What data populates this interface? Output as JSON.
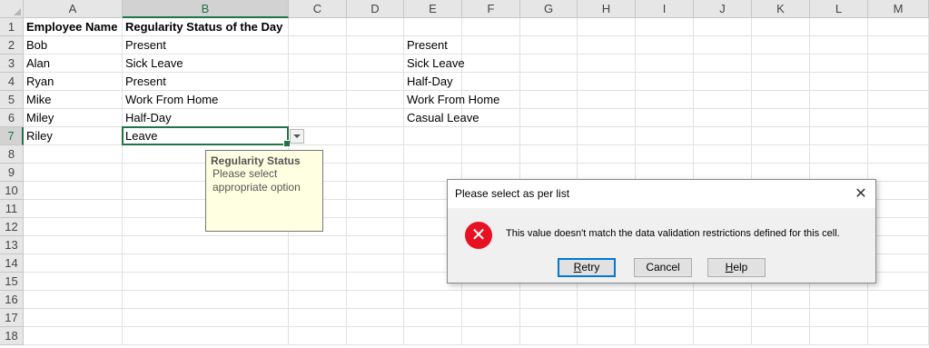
{
  "columns": [
    "A",
    "B",
    "C",
    "D",
    "E",
    "F",
    "G",
    "H",
    "I",
    "J",
    "K",
    "L",
    "M"
  ],
  "rows": [
    "1",
    "2",
    "3",
    "4",
    "5",
    "6",
    "7",
    "8",
    "9",
    "10",
    "11",
    "12",
    "13",
    "14",
    "15",
    "16",
    "17",
    "18"
  ],
  "cells": {
    "A1": "Employee Name",
    "B1": "Regularity Status of the Day",
    "A2": "Bob",
    "B2": "Present",
    "A3": "Alan",
    "B3": "Sick Leave",
    "A4": "Ryan",
    "B4": "Present",
    "A5": "Mike",
    "B5": "Work From Home",
    "A6": "Miley",
    "B6": "Half-Day",
    "A7": "Riley",
    "B7": "Leave",
    "E2": "Present",
    "E3": "Sick Leave",
    "E4": "Half-Day",
    "E5": "Work From Home",
    "E6": "Casual Leave"
  },
  "active_cell": "B7",
  "input_message": {
    "title": "Regularity Status",
    "body": "Please select appropriate option"
  },
  "dialog": {
    "title": "Please select as per list",
    "message": "This value doesn't match the data validation restrictions defined for this cell.",
    "icon": "error-x-icon",
    "buttons": {
      "retry": {
        "first": "R",
        "rest": "etry"
      },
      "cancel": "Cancel",
      "help": {
        "first": "H",
        "rest": "elp"
      }
    },
    "close_glyph": "✕",
    "error_glyph": "✕"
  },
  "colors": {
    "accent": "#217346",
    "error": "#e81123",
    "tooltip_bg": "#ffffe1"
  }
}
